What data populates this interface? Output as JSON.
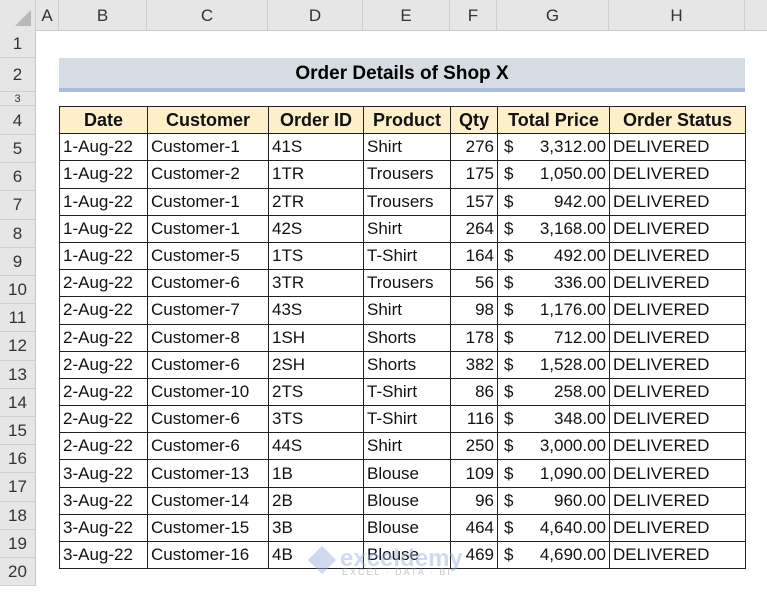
{
  "columns": [
    "A",
    "B",
    "C",
    "D",
    "E",
    "F",
    "G",
    "H"
  ],
  "rows": [
    "1",
    "2",
    "3",
    "4",
    "5",
    "6",
    "7",
    "8",
    "9",
    "10",
    "11",
    "12",
    "13",
    "14",
    "15",
    "16",
    "17",
    "18",
    "19",
    "20"
  ],
  "title": "Order Details of Shop X",
  "table": {
    "headers": [
      "Date",
      "Customer",
      "Order ID",
      "Product",
      "Qty",
      "Total Price",
      "Order Status"
    ],
    "rows": [
      [
        "1-Aug-22",
        "Customer-1",
        "41S",
        "Shirt",
        "276",
        "$",
        "3,312.00",
        "DELIVERED"
      ],
      [
        "1-Aug-22",
        "Customer-2",
        "1TR",
        "Trousers",
        "175",
        "$",
        "1,050.00",
        "DELIVERED"
      ],
      [
        "1-Aug-22",
        "Customer-1",
        "2TR",
        "Trousers",
        "157",
        "$",
        "942.00",
        "DELIVERED"
      ],
      [
        "1-Aug-22",
        "Customer-1",
        "42S",
        "Shirt",
        "264",
        "$",
        "3,168.00",
        "DELIVERED"
      ],
      [
        "1-Aug-22",
        "Customer-5",
        "1TS",
        "T-Shirt",
        "164",
        "$",
        "492.00",
        "DELIVERED"
      ],
      [
        "2-Aug-22",
        "Customer-6",
        "3TR",
        "Trousers",
        "56",
        "$",
        "336.00",
        "DELIVERED"
      ],
      [
        "2-Aug-22",
        "Customer-7",
        "43S",
        "Shirt",
        "98",
        "$",
        "1,176.00",
        "DELIVERED"
      ],
      [
        "2-Aug-22",
        "Customer-8",
        "1SH",
        "Shorts",
        "178",
        "$",
        "712.00",
        "DELIVERED"
      ],
      [
        "2-Aug-22",
        "Customer-6",
        "2SH",
        "Shorts",
        "382",
        "$",
        "1,528.00",
        "DELIVERED"
      ],
      [
        "2-Aug-22",
        "Customer-10",
        "2TS",
        "T-Shirt",
        "86",
        "$",
        "258.00",
        "DELIVERED"
      ],
      [
        "2-Aug-22",
        "Customer-6",
        "3TS",
        "T-Shirt",
        "116",
        "$",
        "348.00",
        "DELIVERED"
      ],
      [
        "2-Aug-22",
        "Customer-6",
        "44S",
        "Shirt",
        "250",
        "$",
        "3,000.00",
        "DELIVERED"
      ],
      [
        "3-Aug-22",
        "Customer-13",
        "1B",
        "Blouse",
        "109",
        "$",
        "1,090.00",
        "DELIVERED"
      ],
      [
        "3-Aug-22",
        "Customer-14",
        "2B",
        "Blouse",
        "96",
        "$",
        "960.00",
        "DELIVERED"
      ],
      [
        "3-Aug-22",
        "Customer-15",
        "3B",
        "Blouse",
        "464",
        "$",
        "4,640.00",
        "DELIVERED"
      ],
      [
        "3-Aug-22",
        "Customer-16",
        "4B",
        "Blouse",
        "469",
        "$",
        "4,690.00",
        "DELIVERED"
      ]
    ]
  },
  "watermark": {
    "name": "exceldemy",
    "tagline": "EXCEL · DATA · BI"
  },
  "colors": {
    "title_bg": "#d6dce4",
    "title_border": "#a7bde0",
    "header_bg": "#fdefc9"
  }
}
